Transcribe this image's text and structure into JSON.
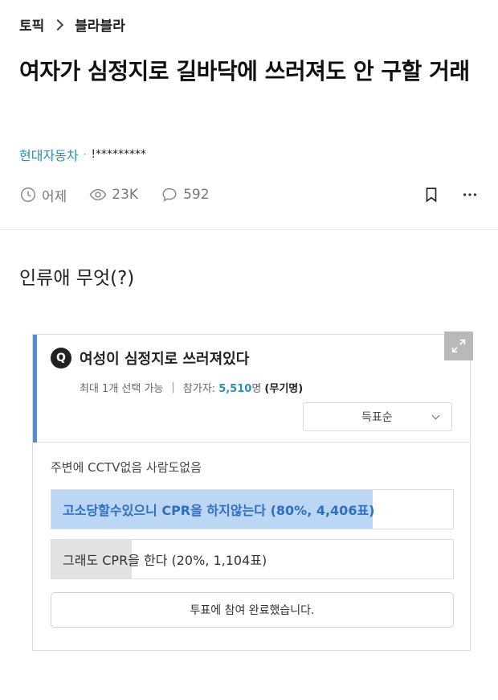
{
  "breadcrumb": {
    "root": "토픽",
    "current": "블라블라"
  },
  "post": {
    "title": "여자가 심정지로 길바닥에 쓰러져도 안 구할 거래",
    "company": "현대자동차",
    "author": "!*********",
    "time": "어제",
    "views": "23K",
    "comments": "592",
    "body": "인류애 무엇(?)"
  },
  "poll": {
    "question": "여성이 심정지로 쓰러져있다",
    "badge": "Q",
    "limit": "최대 1개 선택 가능",
    "participants_label": "참가자:",
    "participants_count": "5,510",
    "participants_unit": "명",
    "anonymous": "(무기명)",
    "sort_label": "득표순",
    "description": "주변에 CCTV없음 사람도없음",
    "options": [
      {
        "label": "고소당할수있으니 CPR을 하지않는다 (80%, 4,406표)",
        "percent": 80
      },
      {
        "label": "그래도 CPR을 한다 (20%, 1,104표)",
        "percent": 20
      }
    ],
    "done_label": "투표에 참여 완료했습니다."
  }
}
